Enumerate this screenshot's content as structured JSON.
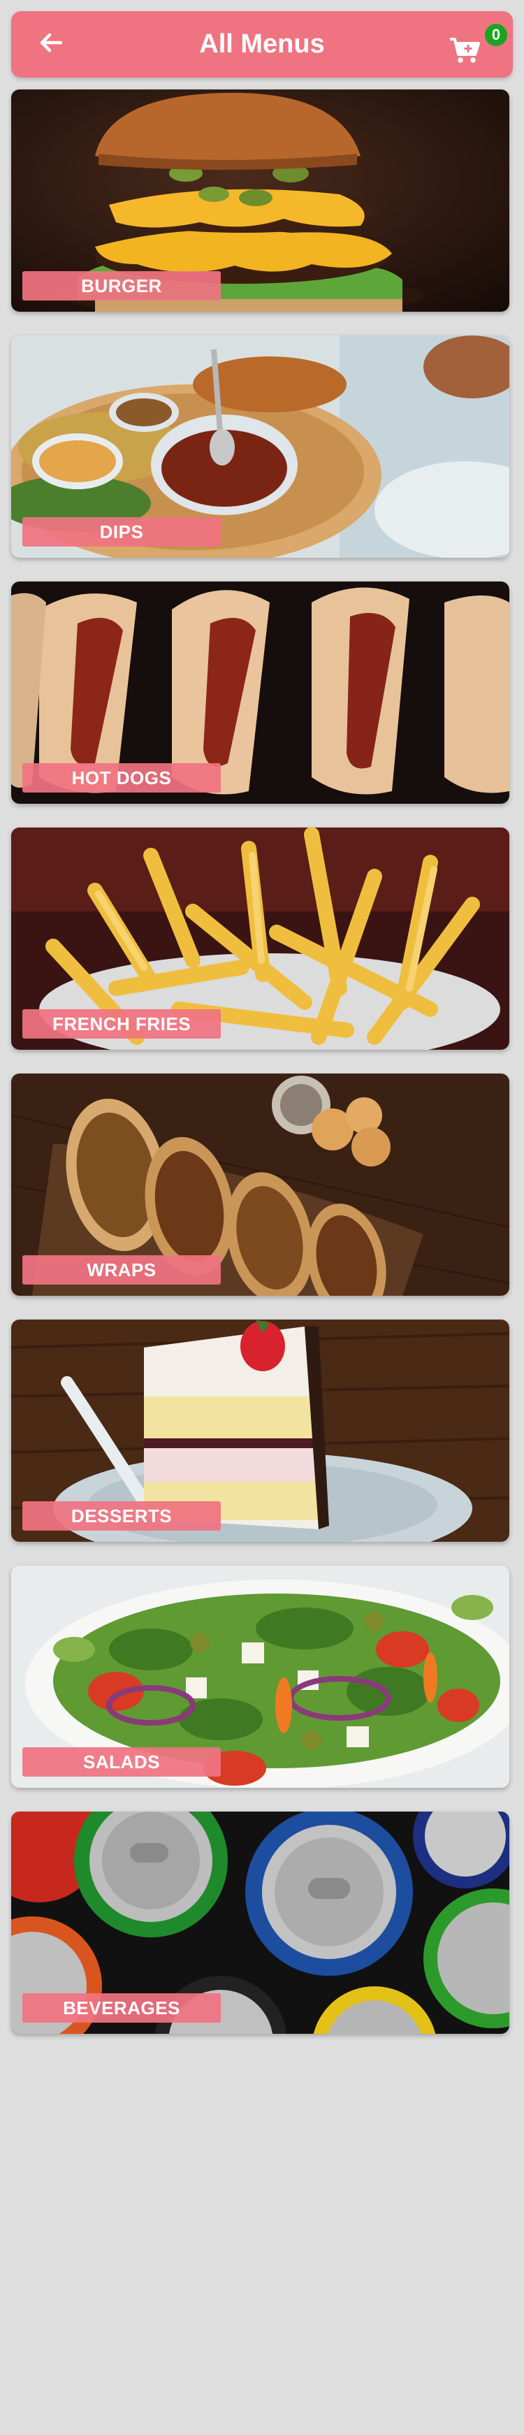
{
  "header": {
    "title": "All Menus",
    "back_icon": "arrow-left-icon",
    "cart_icon": "shopping-cart-icon",
    "cart_count": "0"
  },
  "menus": [
    {
      "label": "BURGER",
      "image": "burger"
    },
    {
      "label": "DIPS",
      "image": "dips"
    },
    {
      "label": "HOT DOGS",
      "image": "hot-dogs"
    },
    {
      "label": "FRENCH FRIES",
      "image": "french-fries"
    },
    {
      "label": "WRAPS",
      "image": "wraps"
    },
    {
      "label": "DESSERTS",
      "image": "desserts"
    },
    {
      "label": "SALADS",
      "image": "salads"
    },
    {
      "label": "BEVERAGES",
      "image": "beverages"
    }
  ],
  "colors": {
    "accent": "#f07381",
    "badge": "#1aa51f",
    "background": "#dedede"
  }
}
